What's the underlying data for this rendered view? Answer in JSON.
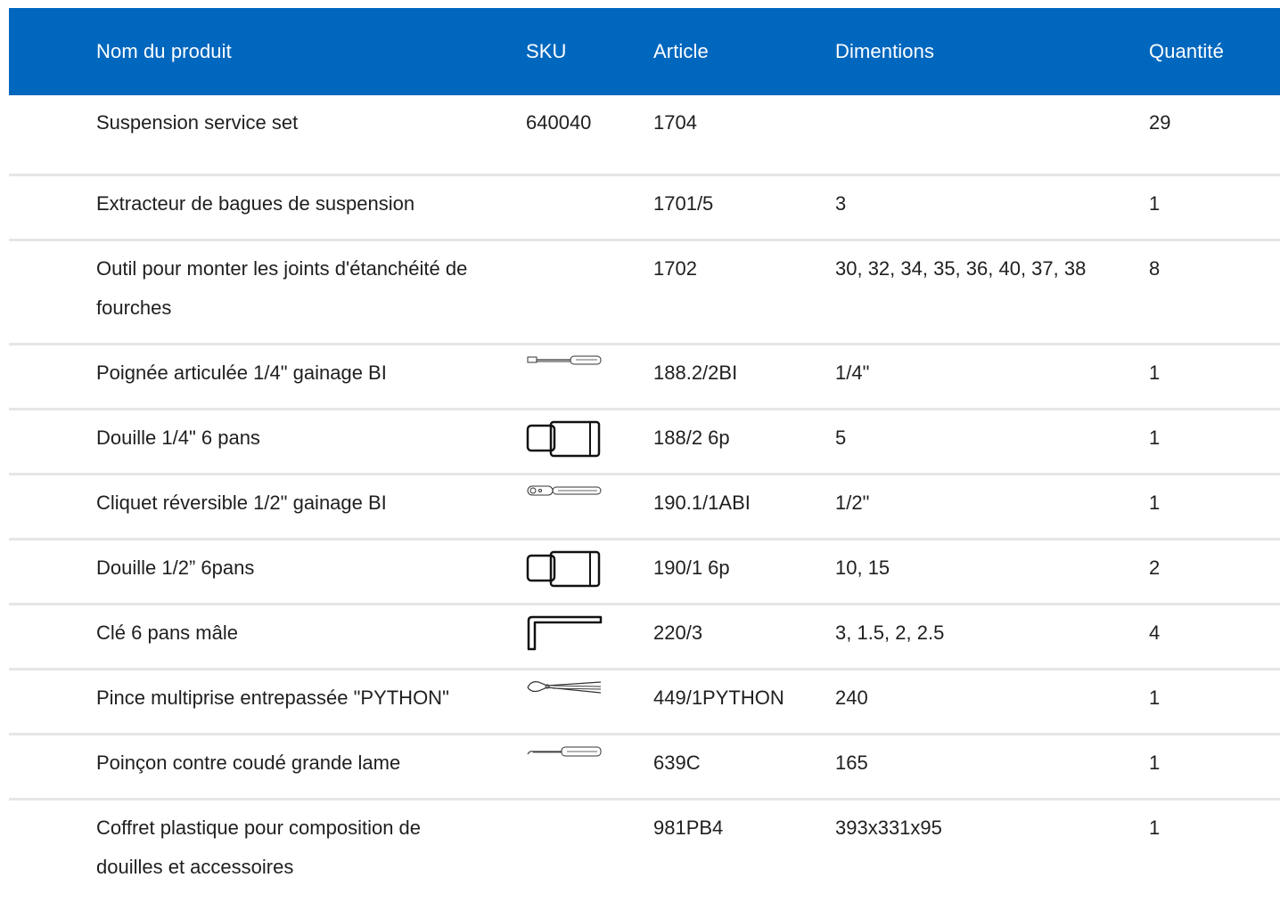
{
  "header": {
    "name": "Nom du produit",
    "sku": "SKU",
    "article": "Article",
    "dimensions": "Dimentions",
    "quantity": "Quantité"
  },
  "rows": [
    {
      "name": "Suspension service set",
      "sku": "640040",
      "article": "1704",
      "dimensions": "",
      "quantity": "29"
    },
    {
      "name": "Extracteur de bagues de suspension",
      "sku": "",
      "article": "1701/5",
      "dimensions": "3",
      "quantity": "1"
    },
    {
      "name": "Outil pour monter les joints d'étanchéité de fourches",
      "sku": "",
      "article": "1702",
      "dimensions": "30, 32, 34, 35, 36, 40, 37, 38",
      "quantity": "8"
    },
    {
      "name": "Poignée articulée 1/4\" gainage BI",
      "sku_icon": "hinged-handle-icon",
      "article": "188.2/2BI",
      "dimensions": "1/4\"",
      "quantity": "1"
    },
    {
      "name": "Douille 1/4\" 6 pans",
      "sku_icon": "socket-icon",
      "article": "188/2 6p",
      "dimensions": "5",
      "quantity": "1"
    },
    {
      "name": "Cliquet réversible 1/2\" gainage BI",
      "sku_icon": "ratchet-icon",
      "article": "190.1/1ABI",
      "dimensions": "1/2\"",
      "quantity": "1"
    },
    {
      "name": "Douille 1/2” 6pans",
      "sku_icon": "socket-icon",
      "article": "190/1 6p",
      "dimensions": "10, 15",
      "quantity": "2"
    },
    {
      "name": "Clé 6 pans mâle",
      "sku_icon": "hex-key-icon",
      "article": "220/3",
      "dimensions": "3, 1.5, 2, 2.5",
      "quantity": "4"
    },
    {
      "name": "Pince multiprise entrepassée \"PYTHON\"",
      "sku_icon": "pliers-icon",
      "article": "449/1PYTHON",
      "dimensions": "240",
      "quantity": "1"
    },
    {
      "name": "Poinçon contre coudé grande lame",
      "sku_icon": "awl-icon",
      "article": "639C",
      "dimensions": "165",
      "quantity": "1"
    },
    {
      "name": "Coffret plastique pour composition de douilles et accessoires",
      "sku": "",
      "article": "981PB4",
      "dimensions": "393x331x95",
      "quantity": "1"
    }
  ],
  "colors": {
    "header_bg": "#0067be",
    "header_text": "#ffffff",
    "row_divider": "#e6e6e6"
  }
}
